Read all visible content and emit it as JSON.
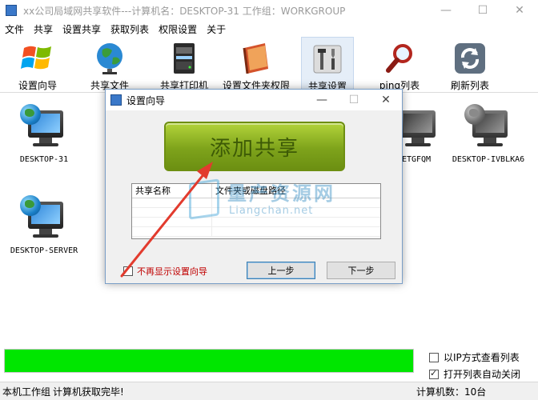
{
  "window": {
    "title": "xx公司局域网共享软件---计算机名：DESKTOP-31   工作组：WORKGROUP",
    "minimize": "—",
    "maximize": "☐",
    "close": "✕"
  },
  "menu": [
    "文件",
    "共享",
    "设置共享",
    "获取列表",
    "权限设置",
    "关于"
  ],
  "toolbar": [
    {
      "label": "设置向导",
      "icon": "windows-logo-icon"
    },
    {
      "label": "共享文件",
      "icon": "globe-icon"
    },
    {
      "label": "共享打印机",
      "icon": "printer-icon"
    },
    {
      "label": "设置文件夹权限",
      "icon": "folder-book-icon"
    },
    {
      "label": "共享设置",
      "icon": "tools-icon"
    },
    {
      "label": "ping列表",
      "icon": "magnifier-icon"
    },
    {
      "label": "刷新列表",
      "icon": "refresh-icon"
    }
  ],
  "computers": [
    {
      "label": "DESKTOP-31"
    },
    {
      "label": "ETGFQM"
    },
    {
      "label": "DESKTOP-IVBLKA6"
    },
    {
      "label": "DESKTOP-SERVER"
    }
  ],
  "dialog": {
    "title": "设置向导",
    "minimize": "—",
    "maximize": "☐",
    "close": "✕",
    "add_share": "添加共享",
    "columns": [
      "共享名称",
      "文件夹或磁盘路径"
    ],
    "no_show_label": "不再显示设置向导",
    "prev_label": "上一步",
    "next_label": "下一步"
  },
  "watermark": {
    "title": "量产资源网",
    "subtitle": "Liangchan.net"
  },
  "options": {
    "ip_view": "以IP方式查看列表",
    "ip_view_checked": false,
    "auto_close": "打开列表自动关闭",
    "auto_close_checked": true
  },
  "progress": {
    "fraction": 1.0,
    "color": "#00e600"
  },
  "status": {
    "workgroup_label": "本机工作组",
    "message": "计算机获取完毕!",
    "count": "计算机数：10台"
  },
  "colors": {
    "accent_green": "#7ea31b",
    "arrow_red": "#e23b2e"
  }
}
